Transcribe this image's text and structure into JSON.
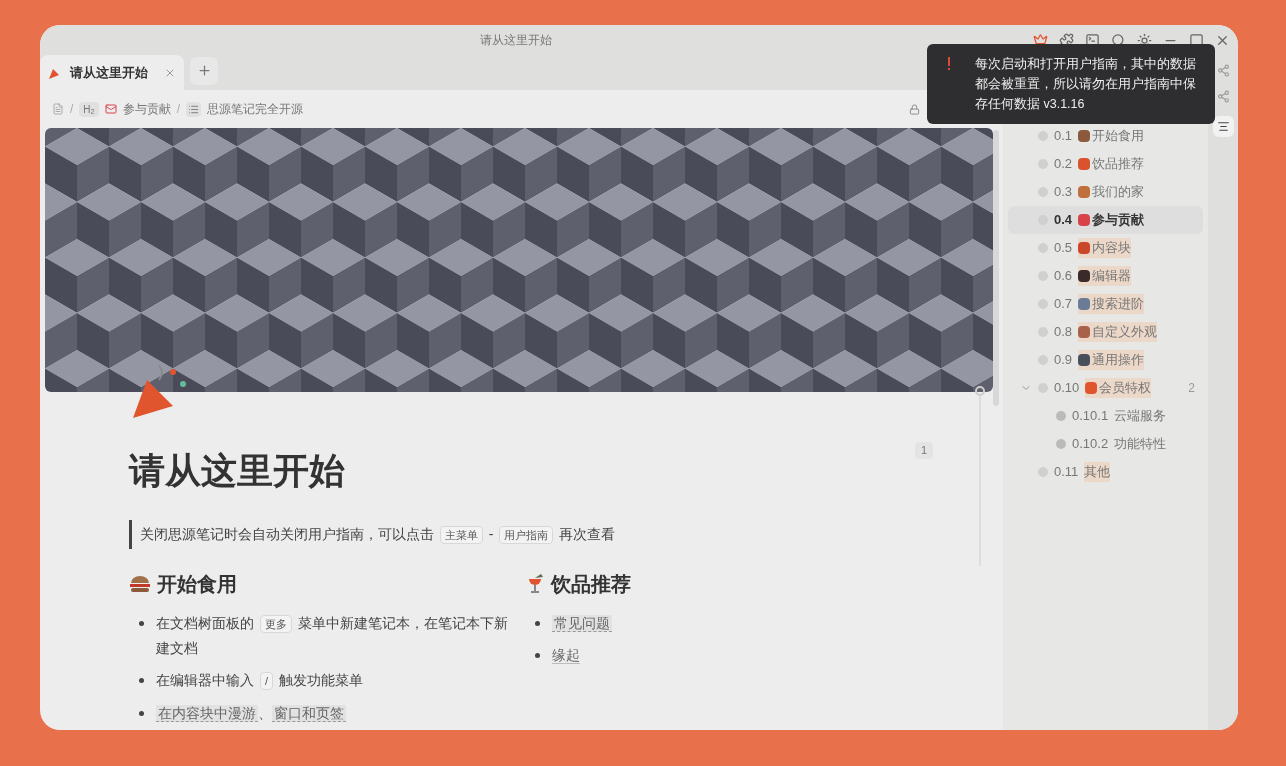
{
  "window": {
    "title": "请从这里开始"
  },
  "tabs": [
    {
      "label": "请从这里开始",
      "selected": true
    }
  ],
  "breadcrumb": [
    {
      "kind": "heading",
      "separator": "/",
      "badge": "H$_{2}$",
      "label": "参与贡献"
    },
    {
      "kind": "list",
      "separator": "/",
      "label": "思源笔记完全开源"
    }
  ],
  "toast": {
    "message": "每次启动和打开用户指南，其中的数据都会被重置，所以请勿在用户指南中保存任何数据 v3.1.16"
  },
  "document": {
    "title": "请从这里开始",
    "counter": "1",
    "quote": [
      {
        "kind": "text",
        "text": "关闭思源笔记时会自动关闭用户指南，可以点击 "
      },
      {
        "kind": "key",
        "text": "主菜单"
      },
      {
        "kind": "text",
        "text": " - "
      },
      {
        "kind": "key",
        "text": "用户指南"
      },
      {
        "kind": "text",
        "text": " 再次查看"
      }
    ],
    "sections": [
      {
        "heading": "开始食用",
        "kind": "burger",
        "items": [
          [
            {
              "kind": "text",
              "text": "在文档树面板的 "
            },
            {
              "kind": "key",
              "text": "更多"
            },
            {
              "kind": "text",
              "text": " 菜单中新建笔记本，在笔记本下新建文档"
            }
          ],
          [
            {
              "kind": "text",
              "text": "在编辑器中输入 "
            },
            {
              "kind": "key",
              "text": "/"
            },
            {
              "kind": "text",
              "text": " 触发功能菜单"
            }
          ],
          [
            {
              "kind": "ref",
              "text": "在内容块中漫游"
            },
            {
              "kind": "text",
              "text": "、"
            },
            {
              "kind": "ref",
              "text": "窗口和页签"
            }
          ]
        ]
      },
      {
        "heading": "饮品推荐",
        "kind": "cocktail",
        "items": [
          [
            {
              "kind": "ref",
              "text": "常见问题"
            }
          ],
          [
            {
              "kind": "link",
              "text": "缘起"
            }
          ]
        ]
      }
    ]
  },
  "outline": [
    {
      "number": "0.1",
      "label": "开始食用",
      "color": "#8b5a3c",
      "selected": false,
      "highlighted": false
    },
    {
      "number": "0.2",
      "label": "饮品推荐",
      "color": "#d9542c",
      "selected": false,
      "highlighted": false
    },
    {
      "number": "0.3",
      "label": "我们的家",
      "color": "#c0703a",
      "selected": false,
      "highlighted": false
    },
    {
      "number": "0.4",
      "label": "参与贡献",
      "color": "#d8434a",
      "selected": true,
      "highlighted": false
    },
    {
      "number": "0.5",
      "label": "内容块",
      "color": "#c9482a",
      "selected": false,
      "highlighted": true
    },
    {
      "number": "0.6",
      "label": "编辑器",
      "color": "#3a2a2a",
      "selected": false,
      "highlighted": true
    },
    {
      "number": "0.7",
      "label": "搜索进阶",
      "color": "#6b7c99",
      "selected": false,
      "highlighted": true
    },
    {
      "number": "0.8",
      "label": "自定义外观",
      "color": "#a8614a",
      "selected": false,
      "highlighted": true
    },
    {
      "number": "0.9",
      "label": "通用操作",
      "color": "#4a4f5c",
      "selected": false,
      "highlighted": true
    },
    {
      "number": "0.10",
      "label": "会员特权",
      "color": "#e0552d",
      "selected": false,
      "highlighted": true,
      "expanded": true,
      "count": "2",
      "children": [
        {
          "number": "0.10.1",
          "label": "云端服务",
          "selected": false,
          "highlighted": false
        },
        {
          "number": "0.10.2",
          "label": "功能特性",
          "selected": false,
          "highlighted": false
        }
      ]
    },
    {
      "number": "0.11",
      "label": "其他",
      "selected": false,
      "highlighted": true
    }
  ]
}
